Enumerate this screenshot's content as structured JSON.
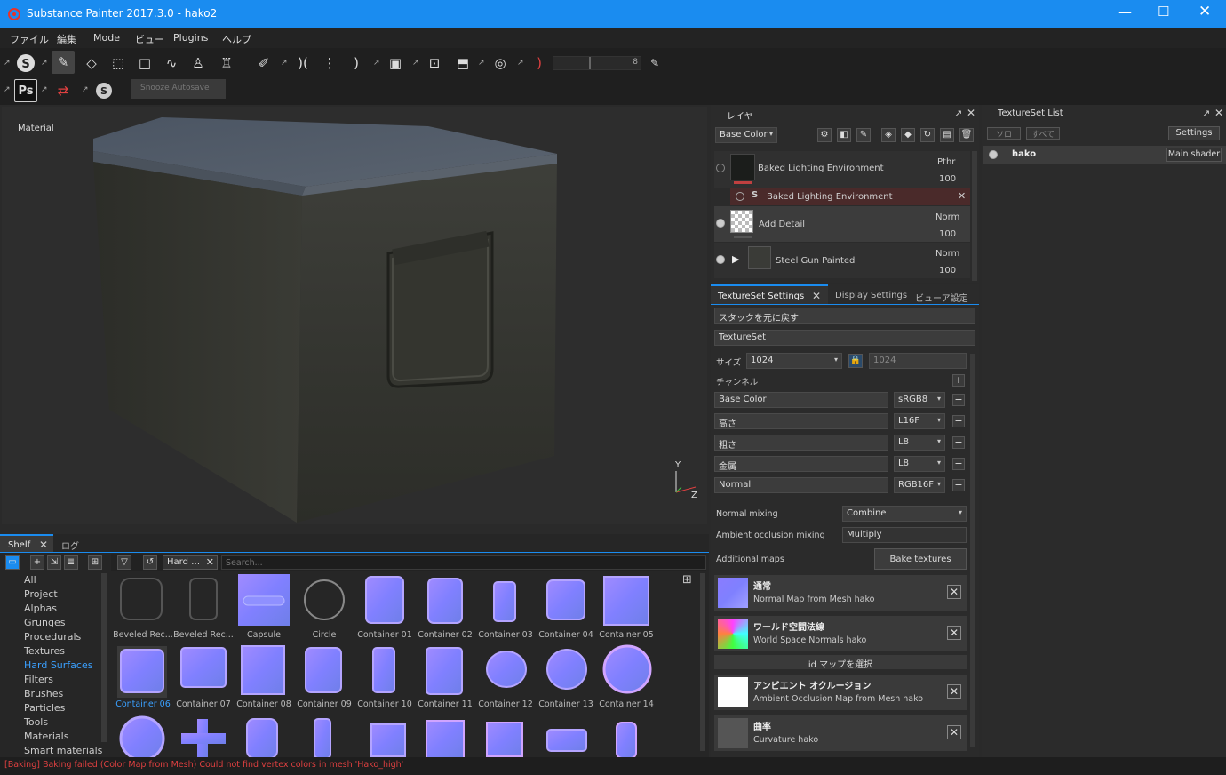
{
  "window": {
    "title": "Substance Painter 2017.3.0 - hako2"
  },
  "menu": [
    "ファイル",
    "編集",
    "Mode",
    "ビュー",
    "Plugins",
    "ヘルプ"
  ],
  "toolbar": {
    "tooltip": "Snooze Autosave",
    "slider_value": "8"
  },
  "viewport": {
    "label": "Material",
    "axis_y": "Y",
    "axis_z": "Z"
  },
  "shelf": {
    "tabs": [
      "Shelf",
      "ログ"
    ],
    "filter_tag": "Hard …",
    "search_placeholder": "Search...",
    "categories": [
      "All",
      "Project",
      "Alphas",
      "Grunges",
      "Procedurals",
      "Textures",
      "Hard Surfaces",
      "Filters",
      "Brushes",
      "Particles",
      "Tools",
      "Materials",
      "Smart materials"
    ],
    "selected_category": "Hard Surfaces",
    "items_row1": [
      "Beveled Rec...",
      "Beveled Rec...",
      "Capsule",
      "Circle",
      "Container 01",
      "Container 02",
      "Container 03",
      "Container 04",
      "Container 05"
    ],
    "items_row2": [
      "Container 06",
      "Container 07",
      "Container 08",
      "Container 09",
      "Container 10",
      "Container 11",
      "Container 12",
      "Container 13",
      "Container 14"
    ]
  },
  "status": "[Baking] Baking failed (Color Map from Mesh) Could not find vertex colors in mesh 'Hako_high'",
  "layers": {
    "title": "レイヤ",
    "channel": "Base Color",
    "items": [
      {
        "name": "Baked Lighting Environment",
        "blend": "Pthr",
        "opacity": "100"
      },
      {
        "name": "Baked Lighting Environment",
        "sub": true
      },
      {
        "name": "Add Detail",
        "blend": "Norm",
        "opacity": "100"
      },
      {
        "name": "Steel Gun Painted",
        "blend": "Norm",
        "opacity": "100"
      }
    ]
  },
  "tss": {
    "tabs": [
      "TextureSet Settings",
      "Display Settings",
      "ビューア設定"
    ],
    "undo_stack": "スタックを元に戻す",
    "textureset": "TextureSet",
    "size_label": "サイズ",
    "size_value": "1024",
    "size_value2": "1024",
    "channels_label": "チャンネル",
    "channels": [
      {
        "name": "Base Color",
        "format": "sRGB8"
      },
      {
        "name": "高さ",
        "format": "L16F"
      },
      {
        "name": "粗さ",
        "format": "L8"
      },
      {
        "name": "金属",
        "format": "L8"
      },
      {
        "name": "Normal",
        "format": "RGB16F"
      }
    ],
    "normal_mixing_label": "Normal mixing",
    "normal_mixing": "Combine",
    "ao_mixing_label": "Ambient occlusion mixing",
    "ao_mixing": "Multiply",
    "additional_maps": "Additional maps",
    "bake_button": "Bake textures",
    "maps": [
      {
        "title": "通常",
        "desc": "Normal Map from Mesh hako"
      },
      {
        "title": "ワールド空間法線",
        "desc": "World Space Normals hako"
      },
      {
        "title": "アンビエント オクルージョン",
        "desc": "Ambient Occlusion Map from Mesh hako"
      },
      {
        "title": "曲率",
        "desc": "Curvature hako"
      }
    ],
    "id_map": "id マップを選択"
  },
  "tslist": {
    "title": "TextureSet List",
    "solo": "ソロ",
    "all": "すべて",
    "settings": "Settings",
    "item": "hako",
    "shader": "Main shader"
  },
  "colors": {
    "accent": "#1a8cf0",
    "selected_text": "#3aa0ff",
    "error": "#e04040"
  }
}
